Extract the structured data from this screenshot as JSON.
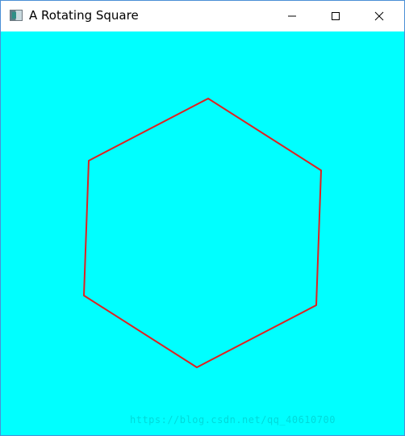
{
  "window": {
    "title": "A Rotating Square",
    "icon": "app-window-icon"
  },
  "caption_buttons": {
    "minimize": "minimize-icon",
    "maximize": "maximize-icon",
    "close": "close-icon"
  },
  "canvas": {
    "background_color": "#00ffff",
    "shape": "hexagon outline",
    "stroke_color": "#e02020"
  },
  "watermark": {
    "text": "https://blog.csdn.net/qq_40610700"
  }
}
